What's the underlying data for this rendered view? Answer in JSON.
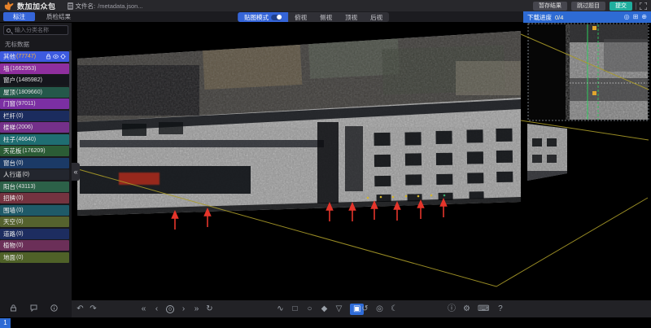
{
  "titlebar": {
    "app_title": "数加加众包",
    "file_label": "文件名:",
    "file_name": "/metadata.json...",
    "actions": [
      {
        "name": "save-draft-button",
        "label": "暂存结果"
      },
      {
        "name": "skip-task-button",
        "label": "跳过题目"
      },
      {
        "name": "submit-button",
        "label": "提交",
        "active": true
      }
    ]
  },
  "tabs": [
    {
      "name": "tab-annotate",
      "label": "标注",
      "active": true
    },
    {
      "name": "tab-qc-result",
      "label": "质检结果"
    }
  ],
  "view_toolbar": {
    "texture_toggle_label": "贴图模式",
    "toggle_on": true,
    "views": [
      {
        "name": "view-top-button",
        "label": "俯视"
      },
      {
        "name": "view-side-button",
        "label": "侧视"
      },
      {
        "name": "view-front-button",
        "label": "顶视"
      },
      {
        "name": "view-back-button",
        "label": "后视"
      }
    ]
  },
  "right_panel": {
    "header_label": "下载进度",
    "header_value": "0/4",
    "icons": [
      {
        "name": "locate-icon",
        "glyph": "◎"
      },
      {
        "name": "grid-icon",
        "glyph": "⊞"
      },
      {
        "name": "expand-icon",
        "glyph": "⊕"
      }
    ]
  },
  "sidebar": {
    "search_placeholder": "输入分类名称",
    "unlabeled_label": "无标数据",
    "footer_icons": [
      "lock-icon",
      "comment-icon",
      "info-icon"
    ],
    "categories": [
      {
        "label": "其他",
        "count": "(77747)",
        "color": "#3d5be0",
        "active": true
      },
      {
        "label": "墙",
        "count": "(1662953)",
        "color": "#8f2f9e"
      },
      {
        "label": "窗户",
        "count": "(1485982)",
        "color": "#15161c"
      },
      {
        "label": "屋顶",
        "count": "(1809660)",
        "color": "#24584a"
      },
      {
        "label": "门窗",
        "count": "(97011)",
        "color": "#7b2fa3"
      },
      {
        "label": "栏杆",
        "count": "(0)",
        "color": "#1b2c5e"
      },
      {
        "label": "楼梯",
        "count": "(2006)",
        "color": "#74308a"
      },
      {
        "label": "柱子",
        "count": "(46640)",
        "color": "#1f6e72"
      },
      {
        "label": "天花板",
        "count": "(176209)",
        "color": "#2b5c35"
      },
      {
        "label": "窗台",
        "count": "(0)",
        "color": "#1b3a66"
      },
      {
        "label": "人行道",
        "count": "(0)",
        "color": "#23262e"
      },
      {
        "label": "阳台",
        "count": "(43113)",
        "color": "#2c6148"
      },
      {
        "label": "招牌",
        "count": "(0)",
        "color": "#743340"
      },
      {
        "label": "围墙",
        "count": "(0)",
        "color": "#1f5a68"
      },
      {
        "label": "天空",
        "count": "(0)",
        "color": "#55622e"
      },
      {
        "label": "道路",
        "count": "(0)",
        "color": "#1d2d60"
      },
      {
        "label": "植物",
        "count": "(0)",
        "color": "#6b2f58"
      },
      {
        "label": "地面",
        "count": "(0)",
        "color": "#4f6128"
      }
    ]
  },
  "canvas": {
    "collapse": "«",
    "undo": "↶",
    "redo": "↷",
    "badge": "1",
    "nav_icons": [
      {
        "name": "first-frame-icon",
        "glyph": "«"
      },
      {
        "name": "prev-frame-icon",
        "glyph": "‹"
      },
      {
        "name": "frame-counter",
        "glyph": "0",
        "cls": "counter"
      },
      {
        "name": "next-frame-icon",
        "glyph": "›"
      },
      {
        "name": "last-frame-icon",
        "glyph": "»"
      },
      {
        "name": "loop-icon",
        "glyph": "↻"
      }
    ],
    "tool_icons": [
      {
        "name": "polyline-tool-icon",
        "glyph": "∿"
      },
      {
        "name": "rect-tool-icon",
        "glyph": "□"
      },
      {
        "name": "circle-tool-icon",
        "glyph": "○"
      },
      {
        "name": "polygon-tool-icon",
        "glyph": "◆"
      },
      {
        "name": "filter-tool-icon",
        "glyph": "▽"
      },
      {
        "name": "brush-tool-icon",
        "glyph": "▣",
        "cls": "active"
      }
    ],
    "util_icons": [
      {
        "name": "reset-view-icon",
        "glyph": "↺"
      },
      {
        "name": "locate-icon",
        "glyph": "◎"
      },
      {
        "name": "night-mode-icon",
        "glyph": "☾"
      }
    ],
    "misc_icons": [
      {
        "name": "info-icon",
        "glyph": "ⓘ"
      },
      {
        "name": "settings-icon",
        "glyph": "⚙"
      },
      {
        "name": "keyboard-icon",
        "glyph": "⌨"
      },
      {
        "name": "help-icon",
        "glyph": "?"
      }
    ]
  }
}
